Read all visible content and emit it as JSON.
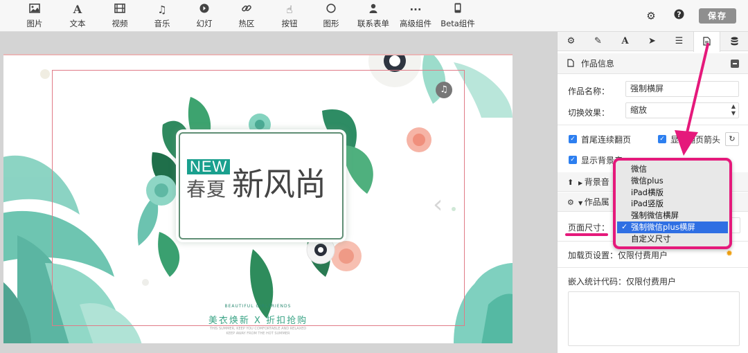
{
  "toolbar": {
    "items": [
      {
        "label": "图片",
        "icon": "image-icon"
      },
      {
        "label": "文本",
        "icon": "text-icon"
      },
      {
        "label": "视频",
        "icon": "video-icon"
      },
      {
        "label": "音乐",
        "icon": "music-icon"
      },
      {
        "label": "幻灯",
        "icon": "slideshow-icon"
      },
      {
        "label": "热区",
        "icon": "link-icon"
      },
      {
        "label": "按钮",
        "icon": "hand-pointer-icon"
      },
      {
        "label": "图形",
        "icon": "circle-icon"
      },
      {
        "label": "联系表单",
        "icon": "user-icon"
      },
      {
        "label": "高级组件",
        "icon": "ellipsis-icon"
      },
      {
        "label": "Beta组件",
        "icon": "mobile-icon"
      }
    ],
    "settings_icon": "gear-icon",
    "help_icon": "question-icon",
    "save_label": "保存"
  },
  "canvas": {
    "new_text": "NEW",
    "title_left": "春夏",
    "title_right": "新风尚",
    "small_caption": "BEAUTIFUL GIRLFRIENDS",
    "slogan": "美衣焕新 X 折扣抢购",
    "slogan_sub_line1": "THIS SUMMER, KEEP YOU COMFORTABLE AND RELAXED",
    "slogan_sub_line2": "KEEP AWAY FROM THE HOT SUMMER"
  },
  "panel": {
    "tabs": [
      {
        "icon": "gear-icon"
      },
      {
        "icon": "pencil-icon"
      },
      {
        "icon": "font-icon"
      },
      {
        "icon": "send-icon"
      },
      {
        "icon": "list-icon"
      },
      {
        "icon": "document-icon"
      },
      {
        "icon": "database-icon"
      }
    ],
    "work_info_title": "作品信息",
    "name_label": "作品名称：",
    "name_value": "强制横屏",
    "transition_label": "切换效果：",
    "transition_value": "缩放",
    "loop_label": "首尾连续翻页",
    "arrow_label_partial": "显示翻页箭头",
    "bg_label_partial": "显示背景音",
    "bg_music_label": "背景音",
    "work_props_label": "作品属",
    "page_size_label": "页面尺寸：",
    "loading_label": "加载页设置：仅限付费用户",
    "stats_label": "嵌入统计代码：仅限付费用户"
  },
  "dropdown": {
    "options": [
      "微信",
      "微信plus",
      "iPad横版",
      "iPad竖版",
      "强制微信横屏",
      "强制微信plus横屏",
      "自定义尺寸"
    ],
    "selected_index": 5
  },
  "colors": {
    "accent_pink": "#e5197b",
    "select_blue": "#2f6fe3",
    "checkbox_blue": "#2d7ff0",
    "teal": "#1aa08e"
  }
}
